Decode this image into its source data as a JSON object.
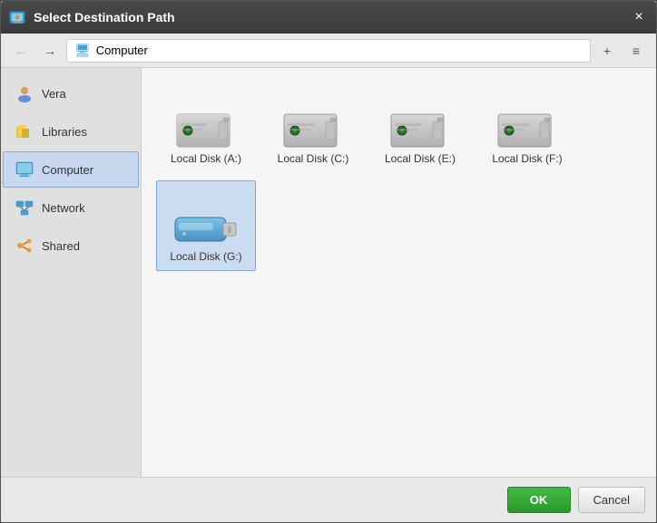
{
  "dialog": {
    "title": "Select Destination Path",
    "close_label": "×"
  },
  "toolbar": {
    "back_label": "←",
    "forward_label": "→",
    "breadcrumb_text": "Computer",
    "new_folder_label": "+",
    "view_label": "≡"
  },
  "sidebar": {
    "items": [
      {
        "id": "vera",
        "label": "Vera",
        "icon": "user-icon"
      },
      {
        "id": "libraries",
        "label": "Libraries",
        "icon": "libraries-icon"
      },
      {
        "id": "computer",
        "label": "Computer",
        "icon": "computer-icon",
        "active": true
      },
      {
        "id": "network",
        "label": "Network",
        "icon": "network-icon"
      },
      {
        "id": "shared",
        "label": "Shared",
        "icon": "shared-icon"
      }
    ]
  },
  "disks": [
    {
      "id": "a",
      "label": "Local Disk (A:)",
      "type": "hdd",
      "selected": false
    },
    {
      "id": "c",
      "label": "Local Disk (C:)",
      "type": "hdd",
      "selected": false
    },
    {
      "id": "e",
      "label": "Local Disk (E:)",
      "type": "hdd",
      "selected": false
    },
    {
      "id": "f",
      "label": "Local Disk (F:)",
      "type": "hdd",
      "selected": false
    },
    {
      "id": "g",
      "label": "Local Disk (G:)",
      "type": "usb",
      "selected": true
    }
  ],
  "buttons": {
    "ok_label": "OK",
    "cancel_label": "Cancel"
  }
}
